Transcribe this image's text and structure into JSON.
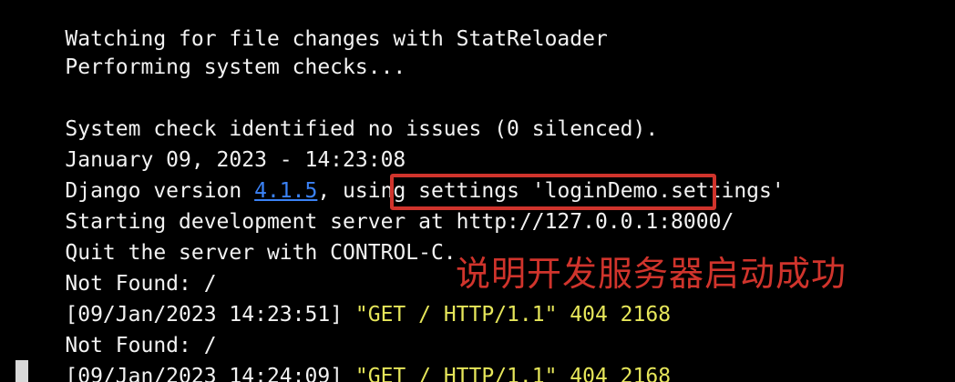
{
  "terminal": {
    "lines": {
      "watching": "Watching for file changes with StatReloader",
      "performing": "Performing system checks...",
      "system_check": "System check identified no issues (0 silenced).",
      "datetime": "January 09, 2023 - 14:23:08",
      "django_prefix": "Django version ",
      "django_version": "4.1.5",
      "django_suffix": ", using settings 'loginDemo.settings'",
      "starting_prefix": "Starting development server at ",
      "server_url": "http://127.0.0.1:8000/",
      "quit": "Quit the server with CONTROL-C.",
      "not_found_1": "Not Found: /",
      "log1_prefix": "[09/Jan/2023 14:23:51] ",
      "log1_request": "\"GET / HTTP/1.1\" 404 2168",
      "not_found_2": "Not Found: /",
      "log2_prefix": "[09/Jan/2023 14:24:09] ",
      "log2_request": "\"GET / HTTP/1.1\" 404 2168"
    }
  },
  "annotation": {
    "text": "说明开发服务器启动成功"
  },
  "colors": {
    "background": "#000000",
    "text": "#f2f2f2",
    "link": "#3b82f6",
    "log_request": "#e6e65a",
    "annotation": "#d0342c"
  }
}
